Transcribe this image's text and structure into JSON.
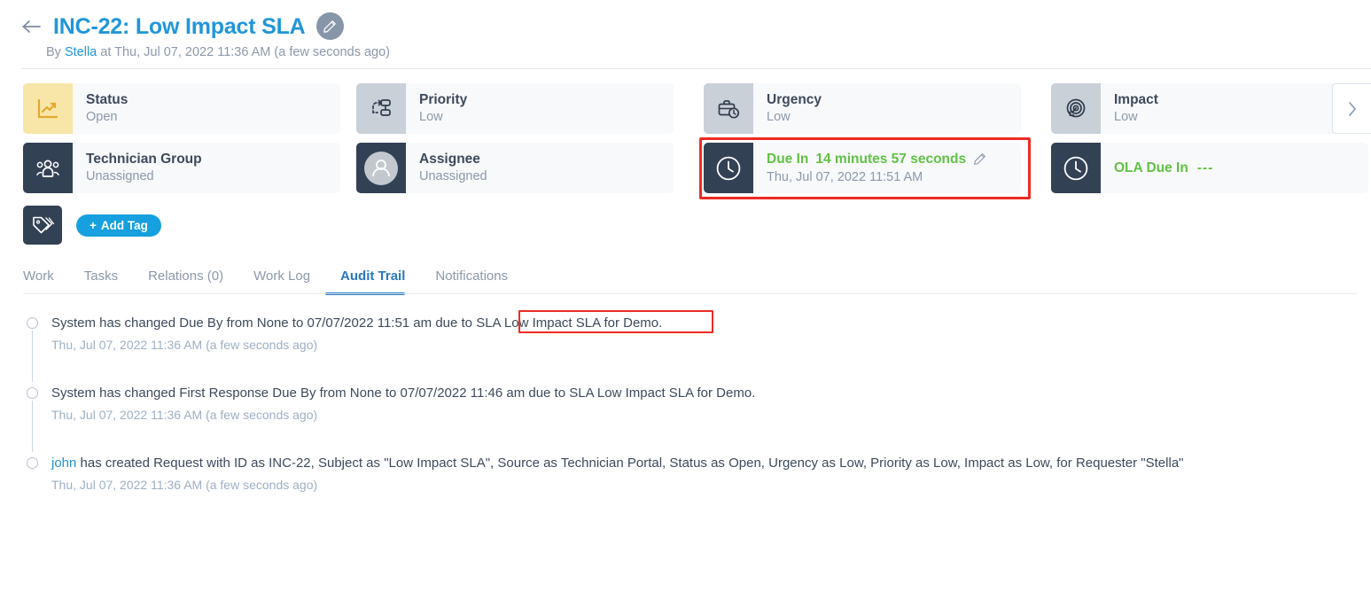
{
  "header": {
    "back_icon": "arrow-left-icon",
    "title": "INC-22: Low Impact SLA",
    "edit_icon": "pencil-icon",
    "byline_prefix": "By ",
    "byline_user": "Stella",
    "byline_suffix": " at Thu, Jul 07, 2022 11:36 AM (a few seconds ago)"
  },
  "cards": {
    "status": {
      "label": "Status",
      "value": "Open",
      "icon": "line-chart-icon"
    },
    "priority": {
      "label": "Priority",
      "value": "Low",
      "icon": "priority-flow-icon"
    },
    "urgency": {
      "label": "Urgency",
      "value": "Low",
      "icon": "briefcase-clock-icon"
    },
    "impact": {
      "label": "Impact",
      "value": "Low",
      "icon": "target-arrow-icon"
    },
    "technician_group": {
      "label": "Technician Group",
      "value": "Unassigned",
      "icon": "people-group-icon"
    },
    "assignee": {
      "label": "Assignee",
      "value": "Unassigned",
      "icon": "user-avatar-icon"
    },
    "due_in": {
      "label": "Due In",
      "value": "14 minutes 57 seconds",
      "sub": "Thu, Jul 07, 2022 11:51 AM",
      "icon": "clock-icon",
      "edit_icon": "pencil-icon"
    },
    "ola_due_in": {
      "label": "OLA Due In",
      "value": "---",
      "icon": "clock-icon"
    },
    "next_icon": "chevron-right-icon"
  },
  "tags": {
    "icon": "tag-icon",
    "add_label": "Add Tag",
    "add_plus": "+"
  },
  "tabs": [
    {
      "label": "Work",
      "active": false
    },
    {
      "label": "Tasks",
      "active": false
    },
    {
      "label": "Relations (0)",
      "active": false
    },
    {
      "label": "Work Log",
      "active": false
    },
    {
      "label": "Audit Trail",
      "active": true
    },
    {
      "label": "Notifications",
      "active": false
    }
  ],
  "audit": [
    {
      "text_before": "System has changed Due By from None to 07/07/2022 11:51 am due to ",
      "text_highlight": "SLA Low Impact SLA for Demo.",
      "time": "Thu, Jul 07, 2022 11:36 AM (a few seconds ago)"
    },
    {
      "text": "System has changed First Response Due By from None to 07/07/2022 11:46 am due to SLA Low Impact SLA for Demo.",
      "time": "Thu, Jul 07, 2022 11:36 AM (a few seconds ago)"
    },
    {
      "user": "john",
      "text": " has created Request with ID as INC-22, Subject as \"Low Impact SLA\", Source as Technician Portal, Status as Open, Urgency as Low, Priority as Low, Impact as Low, for Requester \"Stella\"",
      "time": "Thu, Jul 07, 2022 11:36 AM (a few seconds ago)"
    }
  ],
  "colors": {
    "accent_blue": "#2196d9",
    "tab_active": "#2878c2",
    "green": "#63c144",
    "highlight_red": "#ee2b24",
    "dark_icon_bg": "#334155",
    "gray_icon_bg": "#c9d0d8",
    "yellow_icon_bg": "#f7e6a8"
  }
}
